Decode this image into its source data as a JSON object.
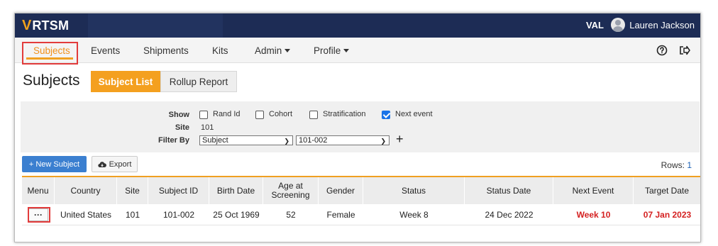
{
  "header": {
    "logo_text": "RTSM",
    "env": "VAL",
    "user_name": "Lauren Jackson"
  },
  "nav": {
    "items": [
      {
        "label": "Subjects",
        "active": true
      },
      {
        "label": "Events"
      },
      {
        "label": "Shipments"
      },
      {
        "label": "Kits"
      },
      {
        "label": "Admin",
        "dropdown": true
      },
      {
        "label": "Profile",
        "dropdown": true
      }
    ],
    "help_icon": "question-circle-icon",
    "logout_icon": "logout-icon"
  },
  "page": {
    "title": "Subjects",
    "tabs": [
      {
        "label": "Subject List",
        "active": true
      },
      {
        "label": "Rollup Report"
      }
    ]
  },
  "filters": {
    "show_label": "Show",
    "options": [
      {
        "label": "Rand Id",
        "checked": false
      },
      {
        "label": "Cohort",
        "checked": false
      },
      {
        "label": "Stratification",
        "checked": false
      },
      {
        "label": "Next event",
        "checked": true
      }
    ],
    "site_label": "Site",
    "site_value": "101",
    "filter_by_label": "Filter By",
    "filter_field": "Subject",
    "filter_value": "101-002",
    "add_symbol": "+"
  },
  "actions": {
    "new_subject": "+ New Subject",
    "export": "Export",
    "rows_label": "Rows:",
    "rows_count": "1"
  },
  "table": {
    "columns": [
      "Menu",
      "Country",
      "Site",
      "Subject ID",
      "Birth Date",
      "Age at Screening",
      "Gender",
      "Status",
      "Status Date",
      "Next Event",
      "Target Date"
    ],
    "rows": [
      {
        "menu": "···",
        "country": "United States",
        "site": "101",
        "subject_id": "101-002",
        "birth_date": "25 Oct 1969",
        "age": "52",
        "gender": "Female",
        "status": "Week 8",
        "status_date": "24 Dec 2022",
        "next_event": "Week 10",
        "target_date": "07 Jan 2023"
      }
    ]
  },
  "colors": {
    "topbar": "#1d2c55",
    "accent": "#f4a01f",
    "primary_button": "#3b7fd0",
    "highlight": "#e23b3b",
    "alert_text": "#d42020"
  }
}
